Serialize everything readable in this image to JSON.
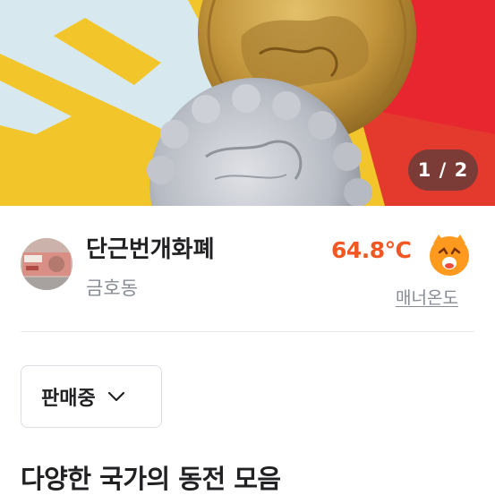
{
  "photo": {
    "counter": "1 / 2",
    "colors": {
      "yellow": "#f2c62b",
      "red": "#e8262f",
      "blue": "#d7e9ef",
      "gold": "#b98a2c",
      "silver": "#b9bcc4"
    }
  },
  "seller": {
    "nickname": "단근번개화폐",
    "location": "금호동",
    "avatar_icon": "banknote-avatar"
  },
  "manner": {
    "temperature": "64.8℃",
    "face_icon": "grinning-face-icon",
    "link_label": "매너온도",
    "color": "#f05723"
  },
  "status": {
    "selected": "판매중",
    "dropdown_icon": "chevron-down-icon"
  },
  "post": {
    "title": "다양한 국가의 동전 모음"
  }
}
